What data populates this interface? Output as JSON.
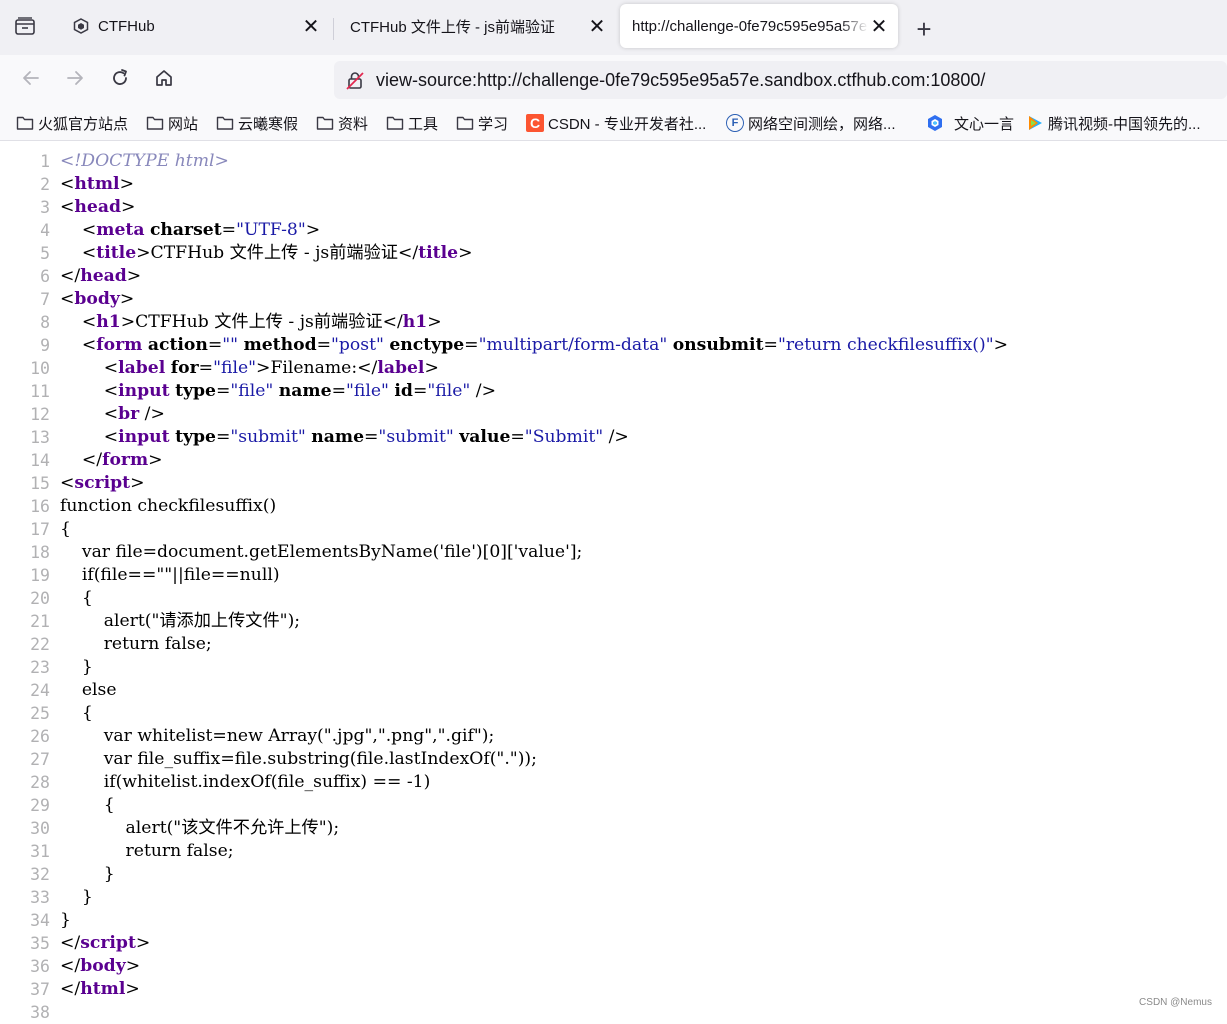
{
  "tabs": [
    {
      "title": "CTFHub",
      "active": false
    },
    {
      "title": "CTFHub 文件上传 - js前端验证",
      "active": false
    },
    {
      "title": "http://challenge-0fe79c595e95a57e.sandbox.ctfhub.com:10800/",
      "active": true
    }
  ],
  "tab_close_glyph": "✕",
  "new_tab_glyph": "+",
  "url": "view-source:http://challenge-0fe79c595e95a57e.sandbox.ctfhub.com:10800/",
  "bookmarks": [
    {
      "label": "火狐官方站点",
      "icon": "folder-icon"
    },
    {
      "label": "网站",
      "icon": "folder-icon"
    },
    {
      "label": "云曦寒假",
      "icon": "folder-icon"
    },
    {
      "label": "资料",
      "icon": "folder-icon"
    },
    {
      "label": "工具",
      "icon": "folder-icon"
    },
    {
      "label": "学习",
      "icon": "folder-icon"
    },
    {
      "label": "CSDN - 专业开发者社...",
      "icon": "csdn-icon",
      "icon_letter": "C"
    },
    {
      "label": "网络空间测绘，网络...",
      "icon": "fofa-icon",
      "icon_letter": "F"
    },
    {
      "label": "文心一言",
      "icon": "wenxin-icon"
    },
    {
      "label": "腾讯视频-中国领先的...",
      "icon": "tencent-video-icon"
    }
  ],
  "source_lines": [
    [
      [
        "dt",
        "<!DOCTYPE html>"
      ]
    ],
    [
      [
        "brk",
        "<"
      ],
      [
        "tag",
        "html"
      ],
      [
        "brk",
        ">"
      ]
    ],
    [
      [
        "brk",
        "<"
      ],
      [
        "tag",
        "head"
      ],
      [
        "brk",
        ">"
      ]
    ],
    [
      [
        "txt",
        "    "
      ],
      [
        "brk",
        "<"
      ],
      [
        "tag",
        "meta"
      ],
      [
        "txt",
        " "
      ],
      [
        "attr",
        "charset"
      ],
      [
        "txt",
        "="
      ],
      [
        "val",
        "\"UTF-8\""
      ],
      [
        "brk",
        ">"
      ]
    ],
    [
      [
        "txt",
        "    "
      ],
      [
        "brk",
        "<"
      ],
      [
        "tag",
        "title"
      ],
      [
        "brk",
        ">"
      ],
      [
        "txt",
        "CTFHub 文件上传 - js前端验证"
      ],
      [
        "brk",
        "</"
      ],
      [
        "tag",
        "title"
      ],
      [
        "brk",
        ">"
      ]
    ],
    [
      [
        "brk",
        "</"
      ],
      [
        "tag",
        "head"
      ],
      [
        "brk",
        ">"
      ]
    ],
    [
      [
        "brk",
        "<"
      ],
      [
        "tag",
        "body"
      ],
      [
        "brk",
        ">"
      ]
    ],
    [
      [
        "txt",
        "    "
      ],
      [
        "brk",
        "<"
      ],
      [
        "tag",
        "h1"
      ],
      [
        "brk",
        ">"
      ],
      [
        "txt",
        "CTFHub 文件上传 - js前端验证"
      ],
      [
        "brk",
        "</"
      ],
      [
        "tag",
        "h1"
      ],
      [
        "brk",
        ">"
      ]
    ],
    [
      [
        "txt",
        "    "
      ],
      [
        "brk",
        "<"
      ],
      [
        "tag",
        "form"
      ],
      [
        "txt",
        " "
      ],
      [
        "attr",
        "action"
      ],
      [
        "txt",
        "="
      ],
      [
        "val",
        "\"\""
      ],
      [
        "txt",
        " "
      ],
      [
        "attr",
        "method"
      ],
      [
        "txt",
        "="
      ],
      [
        "val",
        "\"post\""
      ],
      [
        "txt",
        " "
      ],
      [
        "attr",
        "enctype"
      ],
      [
        "txt",
        "="
      ],
      [
        "val",
        "\"multipart/form-data\""
      ],
      [
        "txt",
        " "
      ],
      [
        "attr",
        "onsubmit"
      ],
      [
        "txt",
        "="
      ],
      [
        "val",
        "\"return checkfilesuffix()\""
      ],
      [
        "brk",
        ">"
      ]
    ],
    [
      [
        "txt",
        "        "
      ],
      [
        "brk",
        "<"
      ],
      [
        "tag",
        "label"
      ],
      [
        "txt",
        " "
      ],
      [
        "attr",
        "for"
      ],
      [
        "txt",
        "="
      ],
      [
        "val",
        "\"file\""
      ],
      [
        "brk",
        ">"
      ],
      [
        "txt",
        "Filename:"
      ],
      [
        "brk",
        "</"
      ],
      [
        "tag",
        "label"
      ],
      [
        "brk",
        ">"
      ]
    ],
    [
      [
        "txt",
        "        "
      ],
      [
        "brk",
        "<"
      ],
      [
        "tag",
        "input"
      ],
      [
        "txt",
        " "
      ],
      [
        "attr",
        "type"
      ],
      [
        "txt",
        "="
      ],
      [
        "val",
        "\"file\""
      ],
      [
        "txt",
        " "
      ],
      [
        "attr",
        "name"
      ],
      [
        "txt",
        "="
      ],
      [
        "val",
        "\"file\""
      ],
      [
        "txt",
        " "
      ],
      [
        "attr",
        "id"
      ],
      [
        "txt",
        "="
      ],
      [
        "val",
        "\"file\""
      ],
      [
        "txt",
        " "
      ],
      [
        "brk",
        "/>"
      ]
    ],
    [
      [
        "txt",
        "        "
      ],
      [
        "brk",
        "<"
      ],
      [
        "tag",
        "br"
      ],
      [
        "txt",
        " "
      ],
      [
        "brk",
        "/>"
      ]
    ],
    [
      [
        "txt",
        "        "
      ],
      [
        "brk",
        "<"
      ],
      [
        "tag",
        "input"
      ],
      [
        "txt",
        " "
      ],
      [
        "attr",
        "type"
      ],
      [
        "txt",
        "="
      ],
      [
        "val",
        "\"submit\""
      ],
      [
        "txt",
        " "
      ],
      [
        "attr",
        "name"
      ],
      [
        "txt",
        "="
      ],
      [
        "val",
        "\"submit\""
      ],
      [
        "txt",
        " "
      ],
      [
        "attr",
        "value"
      ],
      [
        "txt",
        "="
      ],
      [
        "val",
        "\"Submit\""
      ],
      [
        "txt",
        " "
      ],
      [
        "brk",
        "/>"
      ]
    ],
    [
      [
        "txt",
        "    "
      ],
      [
        "brk",
        "</"
      ],
      [
        "tag",
        "form"
      ],
      [
        "brk",
        ">"
      ]
    ],
    [
      [
        "brk",
        "<"
      ],
      [
        "tag",
        "script"
      ],
      [
        "brk",
        ">"
      ]
    ],
    [
      [
        "txt",
        "function checkfilesuffix()"
      ]
    ],
    [
      [
        "txt",
        "{"
      ]
    ],
    [
      [
        "txt",
        "    var file=document.getElementsByName('file')[0]['value'];"
      ]
    ],
    [
      [
        "txt",
        "    if(file==\"\"||file==null)"
      ]
    ],
    [
      [
        "txt",
        "    {"
      ]
    ],
    [
      [
        "txt",
        "        alert(\"请添加上传文件\");"
      ]
    ],
    [
      [
        "txt",
        "        return false;"
      ]
    ],
    [
      [
        "txt",
        "    }"
      ]
    ],
    [
      [
        "txt",
        "    else"
      ]
    ],
    [
      [
        "txt",
        "    {"
      ]
    ],
    [
      [
        "txt",
        "        var whitelist=new Array(\".jpg\",\".png\",\".gif\");"
      ]
    ],
    [
      [
        "txt",
        "        var file_suffix=file.substring(file.lastIndexOf(\".\"));"
      ]
    ],
    [
      [
        "txt",
        "        if(whitelist.indexOf(file_suffix) == -1)"
      ]
    ],
    [
      [
        "txt",
        "        {"
      ]
    ],
    [
      [
        "txt",
        "            alert(\"该文件不允许上传\");"
      ]
    ],
    [
      [
        "txt",
        "            return false;"
      ]
    ],
    [
      [
        "txt",
        "        }"
      ]
    ],
    [
      [
        "txt",
        "    }"
      ]
    ],
    [
      [
        "txt",
        "}"
      ]
    ],
    [
      [
        "brk",
        "</"
      ],
      [
        "tag",
        "script"
      ],
      [
        "brk",
        ">"
      ]
    ],
    [
      [
        "brk",
        "</"
      ],
      [
        "tag",
        "body"
      ],
      [
        "brk",
        ">"
      ]
    ],
    [
      [
        "brk",
        "</"
      ],
      [
        "tag",
        "html"
      ],
      [
        "brk",
        ">"
      ]
    ],
    []
  ],
  "watermark": "CSDN @Nemus"
}
